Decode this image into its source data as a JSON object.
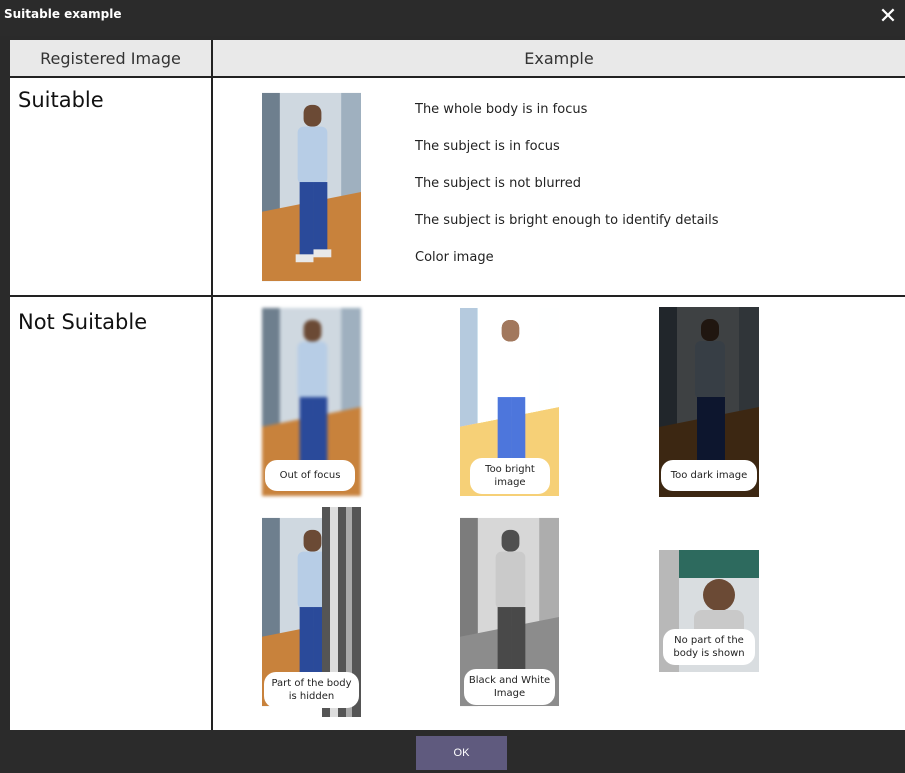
{
  "window": {
    "title": "Suitable example",
    "close_label": "✕"
  },
  "table": {
    "headers": {
      "registered": "Registered Image",
      "example": "Example"
    },
    "suitable": {
      "label": "Suitable",
      "criteria": [
        "The whole body is in focus",
        "The subject is in focus",
        "The subject is not blurred",
        "The subject is bright enough to identify details",
        "Color image"
      ]
    },
    "not_suitable": {
      "label": "Not Suitable",
      "examples": [
        "Out of focus",
        "Too bright image",
        "Too dark image",
        "Part of the body is hidden",
        "Black and White Image",
        "No part of the body is shown"
      ]
    }
  },
  "footer": {
    "ok_label": "OK"
  },
  "colors": {
    "titlebar": "#2b2b2b",
    "ok_button": "#5f5a7e",
    "header_bg": "#e9e9e9"
  }
}
